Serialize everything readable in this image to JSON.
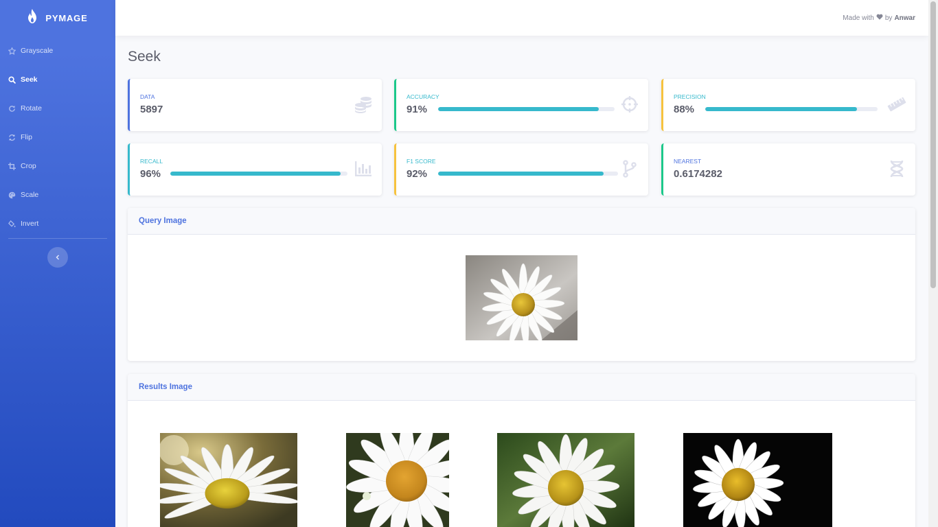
{
  "brand": {
    "name": "PYMAGE"
  },
  "sidebar": {
    "items": [
      {
        "label": "Grayscale",
        "icon": "star-icon",
        "active": false
      },
      {
        "label": "Seek",
        "icon": "search-icon",
        "active": true
      },
      {
        "label": "Rotate",
        "icon": "redo-icon",
        "active": false
      },
      {
        "label": "Flip",
        "icon": "sync-icon",
        "active": false
      },
      {
        "label": "Crop",
        "icon": "crop-icon",
        "active": false
      },
      {
        "label": "Scale",
        "icon": "palette-icon",
        "active": false
      },
      {
        "label": "Invert",
        "icon": "fill-drip-icon",
        "active": false
      }
    ],
    "toggle_icon": "chevron-left-icon"
  },
  "topbar": {
    "made_with": "Made with",
    "by": "by",
    "author": "Anwar",
    "heart_icon": "heart-icon"
  },
  "page": {
    "title": "Seek"
  },
  "cards": [
    {
      "label": "DATA",
      "value": "5897",
      "accent": "#4e73df",
      "label_color": "#4e73df",
      "icon": "database-icon"
    },
    {
      "label": "ACCURACY",
      "value": "91%",
      "progress": 0.91,
      "accent": "#1cc88a",
      "label_color": "#36b9cc",
      "icon": "crosshairs-icon"
    },
    {
      "label": "PRECISION",
      "value": "88%",
      "progress": 0.88,
      "accent": "#f6c23e",
      "label_color": "#36b9cc",
      "icon": "ruler-icon"
    },
    {
      "label": "RECALL",
      "value": "96%",
      "progress": 0.96,
      "accent": "#36b9cc",
      "label_color": "#36b9cc",
      "icon": "chart-bar-icon"
    },
    {
      "label": "F1 SCORE",
      "value": "92%",
      "progress": 0.92,
      "accent": "#f6c23e",
      "label_color": "#36b9cc",
      "icon": "code-branch-icon"
    },
    {
      "label": "NEAREST",
      "value": "0.6174282",
      "accent": "#1cc88a",
      "label_color": "#4e73df",
      "icon": "dna-icon"
    }
  ],
  "query_panel": {
    "title": "Query Image"
  },
  "results_panel": {
    "title": "Results Image"
  },
  "colors": {
    "primary": "#4e73df",
    "success": "#1cc88a",
    "info": "#36b9cc",
    "warning": "#f6c23e"
  }
}
